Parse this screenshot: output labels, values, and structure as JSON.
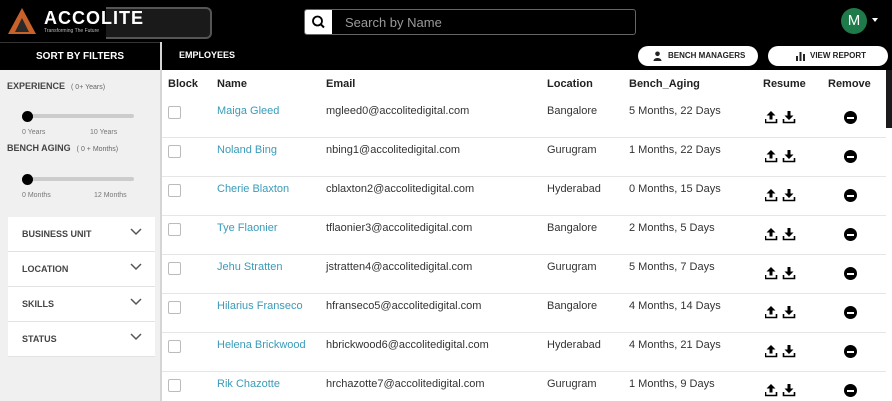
{
  "header": {
    "logo_text": "ACCOLITE",
    "logo_tagline": "Transforming The Future",
    "search_placeholder": "Search by Name",
    "avatar_initial": "M"
  },
  "filters": {
    "title": "SORT BY FILTERS",
    "experience": {
      "label": "EXPERIENCE",
      "sub": "( 0+ Years)",
      "min_label": "0 Years",
      "max_label": "10 Years",
      "value": 0
    },
    "bench_aging": {
      "label": "BENCH AGING",
      "sub": "( 0 + Months)",
      "min_label": "0 Months",
      "max_label": "12 Months",
      "value": 0
    },
    "accordions": [
      {
        "label": "BUSINESS UNIT"
      },
      {
        "label": "LOCATION"
      },
      {
        "label": "SKILLS"
      },
      {
        "label": "STATUS"
      }
    ]
  },
  "employees": {
    "title": "EMPLOYEES",
    "bench_managers_label": "BENCH MANAGERS",
    "view_report_label": "VIEW REPORT",
    "columns": [
      "Block",
      "Name",
      "Email",
      "Location",
      "Bench_Aging",
      "Resume",
      "Remove"
    ],
    "rows": [
      {
        "name": "Maiga Gleed",
        "email": "mgleed0@accolitedigital.com",
        "location": "Bangalore",
        "aging": "5 Months, 22 Days"
      },
      {
        "name": "Noland Bing",
        "email": "nbing1@accolitedigital.com",
        "location": "Gurugram",
        "aging": "1 Months, 22 Days"
      },
      {
        "name": "Cherie Blaxton",
        "email": "cblaxton2@accolitedigital.com",
        "location": "Hyderabad",
        "aging": "0 Months, 15 Days"
      },
      {
        "name": "Tye Flaonier",
        "email": "tflaonier3@accolitedigital.com",
        "location": "Bangalore",
        "aging": "2 Months, 5 Days"
      },
      {
        "name": "Jehu Stratten",
        "email": "jstratten4@accolitedigital.com",
        "location": "Gurugram",
        "aging": "5 Months, 7 Days"
      },
      {
        "name": "Hilarius Franseco",
        "email": "hfranseco5@accolitedigital.com",
        "location": "Bangalore",
        "aging": "4 Months, 14 Days"
      },
      {
        "name": "Helena Brickwood",
        "email": "hbrickwood6@accolitedigital.com",
        "location": "Hyderabad",
        "aging": "4 Months, 21 Days"
      },
      {
        "name": "Rik Chazotte",
        "email": "hrchazotte7@accolitedigital.com",
        "location": "Gurugram",
        "aging": "1 Months, 9 Days"
      }
    ]
  },
  "icons": {
    "search": "search-icon",
    "user": "user-icon",
    "bar_chart": "bar-chart-icon",
    "upload": "upload-icon",
    "download": "download-icon",
    "remove": "remove-circle-icon",
    "chevron": "chevron-down-icon"
  },
  "colors": {
    "topbar_bg": "#000000",
    "accent_orange": "#c8612a",
    "avatar_green": "#1f7a4a",
    "link_blue": "#3a9bb8"
  }
}
